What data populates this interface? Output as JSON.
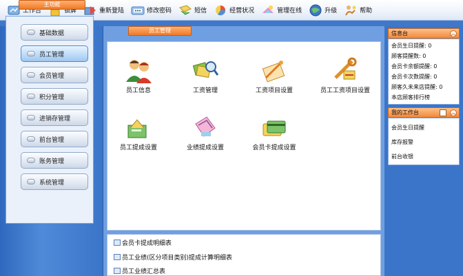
{
  "toolbar": {
    "items": [
      {
        "label": "工作台",
        "icon": "workbench-icon"
      },
      {
        "label": "锁屏",
        "icon": "lock-icon"
      },
      {
        "label": "重新登陆",
        "icon": "relogin-icon"
      },
      {
        "label": "修改密码",
        "icon": "password-icon"
      },
      {
        "label": "短信",
        "icon": "sms-icon"
      },
      {
        "label": "经营状况",
        "icon": "business-status-icon"
      },
      {
        "label": "管理在线",
        "icon": "online-manage-icon"
      },
      {
        "label": "升级",
        "icon": "upgrade-icon"
      },
      {
        "label": "帮助",
        "icon": "help-icon"
      }
    ]
  },
  "left": {
    "tab": "主功能",
    "menu": [
      "基础数据",
      "员工管理",
      "会员管理",
      "积分管理",
      "进销存管理",
      "前台管理",
      "账务管理",
      "系统管理"
    ],
    "active_index": 1
  },
  "center": {
    "tab": "员工管理",
    "functions": [
      {
        "label": "员工信息",
        "icon": "employee-info-icon"
      },
      {
        "label": "工资管理",
        "icon": "salary-manage-icon"
      },
      {
        "label": "工资项目设置",
        "icon": "salary-item-settings-icon"
      },
      {
        "label": "员工工资项目设置",
        "icon": "employee-salary-item-settings-icon"
      },
      {
        "label": "员工提成设置",
        "icon": "employee-commission-settings-icon"
      },
      {
        "label": "业绩提成设置",
        "icon": "performance-commission-settings-icon"
      },
      {
        "label": "会员卡提成设置",
        "icon": "member-card-commission-settings-icon"
      }
    ],
    "reports": [
      "会员卡提成明细表",
      "员工业绩(区分项目类别)提成计算明细表",
      "员工业绩汇总表"
    ]
  },
  "right": {
    "info": {
      "title": "信息台",
      "lines": [
        "会员生日提醒: 0",
        "顾客提醒数: 0",
        "会员卡余额提醒: 0",
        "会员卡次数提醒: 0",
        "顾客久未来店提醒: 0",
        "本店顾客排行榜"
      ]
    },
    "workbench": {
      "title": "我的工作台",
      "lines": [
        "会员生日提醒",
        "库存报警",
        "前台收银"
      ]
    }
  },
  "colors": {
    "accent_orange": "#f07a28",
    "panel_blue": "#3b75c9",
    "active_menu": "#bfdcf8"
  }
}
